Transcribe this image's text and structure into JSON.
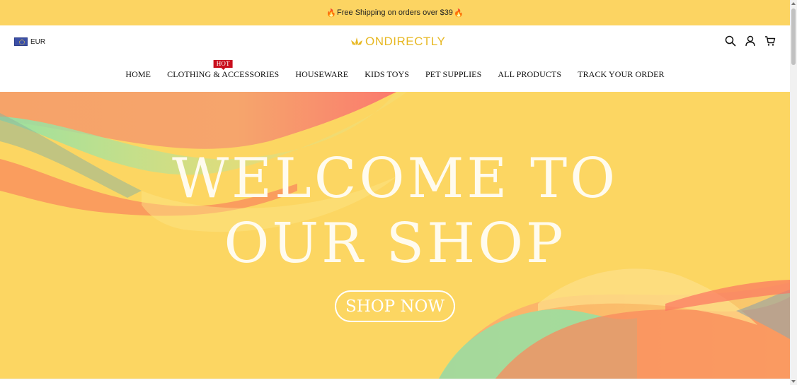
{
  "announcement": {
    "text": "Free Shipping on orders over $39"
  },
  "currency": {
    "code": "EUR"
  },
  "logo": {
    "text": "ONDIRECTLY"
  },
  "icons": [
    "search-icon",
    "user-icon",
    "cart-icon"
  ],
  "nav": {
    "home": "HOME",
    "clothing": "CLOTHING & ACCESSORIES",
    "clothing_badge": "HOT",
    "houseware": "HOUSEWARE",
    "kids_toys": "KIDS TOYS",
    "pet_supplies": "PET SUPPLIES",
    "all_products": "ALL PRODUCTS",
    "track_order": "TRACK YOUR ORDER"
  },
  "hero": {
    "line1": "WELCOME TO",
    "line2": "OUR SHOP",
    "button": "SHOP NOW",
    "background_color": "#fcd662"
  },
  "colors": {
    "accent": "#fcd462",
    "logo": "#e7b823",
    "badge": "#c9101e"
  }
}
